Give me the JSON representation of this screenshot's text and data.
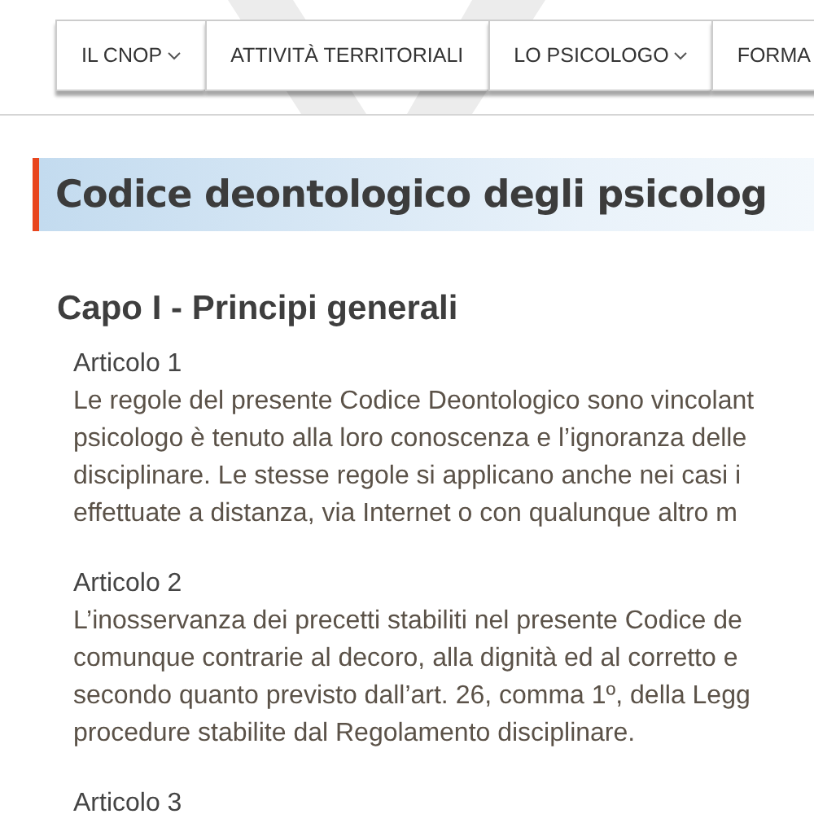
{
  "nav": [
    {
      "label": "IL CNOP",
      "has_menu": true
    },
    {
      "label": "ATTIVITÀ TERRITORIALI",
      "has_menu": false
    },
    {
      "label": "LO PSICOLOGO",
      "has_menu": true
    },
    {
      "label": "FORMA",
      "has_menu": false
    }
  ],
  "page_title": "Codice deontologico degli psicolog",
  "chapter": "Capo I - Principi generali",
  "articles": [
    {
      "heading": "Articolo 1",
      "lines": [
        "Le regole del presente Codice Deontologico sono vincolant",
        "psicologo è tenuto alla loro conoscenza e l’ignoranza delle",
        "disciplinare. Le stesse regole si applicano anche nei casi i",
        "effettuate a distanza, via Internet o con qualunque altro m"
      ]
    },
    {
      "heading": "Articolo 2",
      "lines": [
        "L’inosservanza dei precetti stabiliti nel presente Codice de",
        "comunque contrarie al decoro, alla dignità ed al corretto e",
        "secondo quanto previsto dall’art. 26, comma 1º, della Legg",
        "procedure stabilite dal Regolamento disciplinare."
      ]
    },
    {
      "heading": "Articolo 3"
    }
  ]
}
